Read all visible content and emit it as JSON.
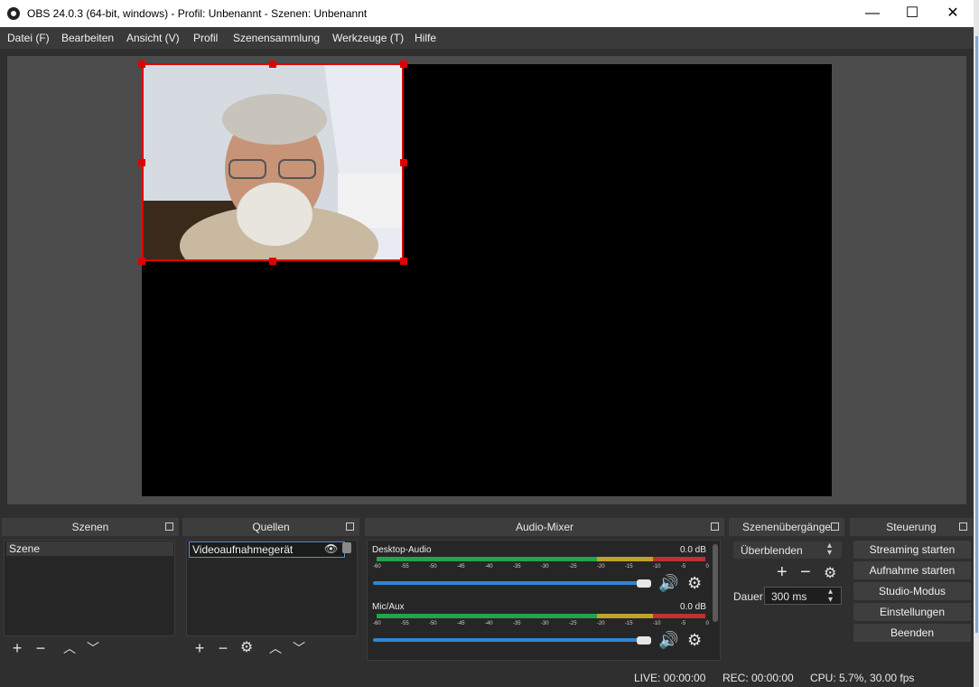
{
  "window": {
    "title": "OBS 24.0.3 (64-bit, windows) - Profil: Unbenannt - Szenen: Unbenannt",
    "minimize_glyph": "—",
    "maximize_glyph": "☐",
    "close_glyph": "✕"
  },
  "menu": [
    "Datei (F)",
    "Bearbeiten",
    "Ansicht (V)",
    "Profil",
    "Szenensammlung",
    "Werkzeuge (T)",
    "Hilfe"
  ],
  "docks": {
    "scenes": {
      "title": "Szenen",
      "items": [
        "Szene"
      ]
    },
    "sources": {
      "title": "Quellen",
      "items": [
        "Videoaufnahmegerät"
      ]
    },
    "mixer": {
      "title": "Audio-Mixer",
      "channels": [
        {
          "name": "Desktop-Audio",
          "level": "0.0 dB"
        },
        {
          "name": "Mic/Aux",
          "level": "0.0 dB"
        }
      ],
      "ticks": [
        "-60",
        "-55",
        "-50",
        "-45",
        "-40",
        "-35",
        "-30",
        "-25",
        "-20",
        "-15",
        "-10",
        "-5",
        "0"
      ]
    },
    "transitions": {
      "title": "Szenenübergänge",
      "selected": "Überblenden",
      "duration_label": "Dauer",
      "duration_value": "300 ms"
    },
    "controls": {
      "title": "Steuerung",
      "buttons": [
        "Streaming starten",
        "Aufnahme starten",
        "Studio-Modus",
        "Einstellungen",
        "Beenden"
      ]
    }
  },
  "status": {
    "live": "LIVE: 00:00:00",
    "rec": "REC: 00:00:00",
    "cpu": "CPU: 5.7%, 30.00 fps"
  },
  "colors": {
    "selection": "#e00000",
    "accent": "#2f86d6"
  }
}
